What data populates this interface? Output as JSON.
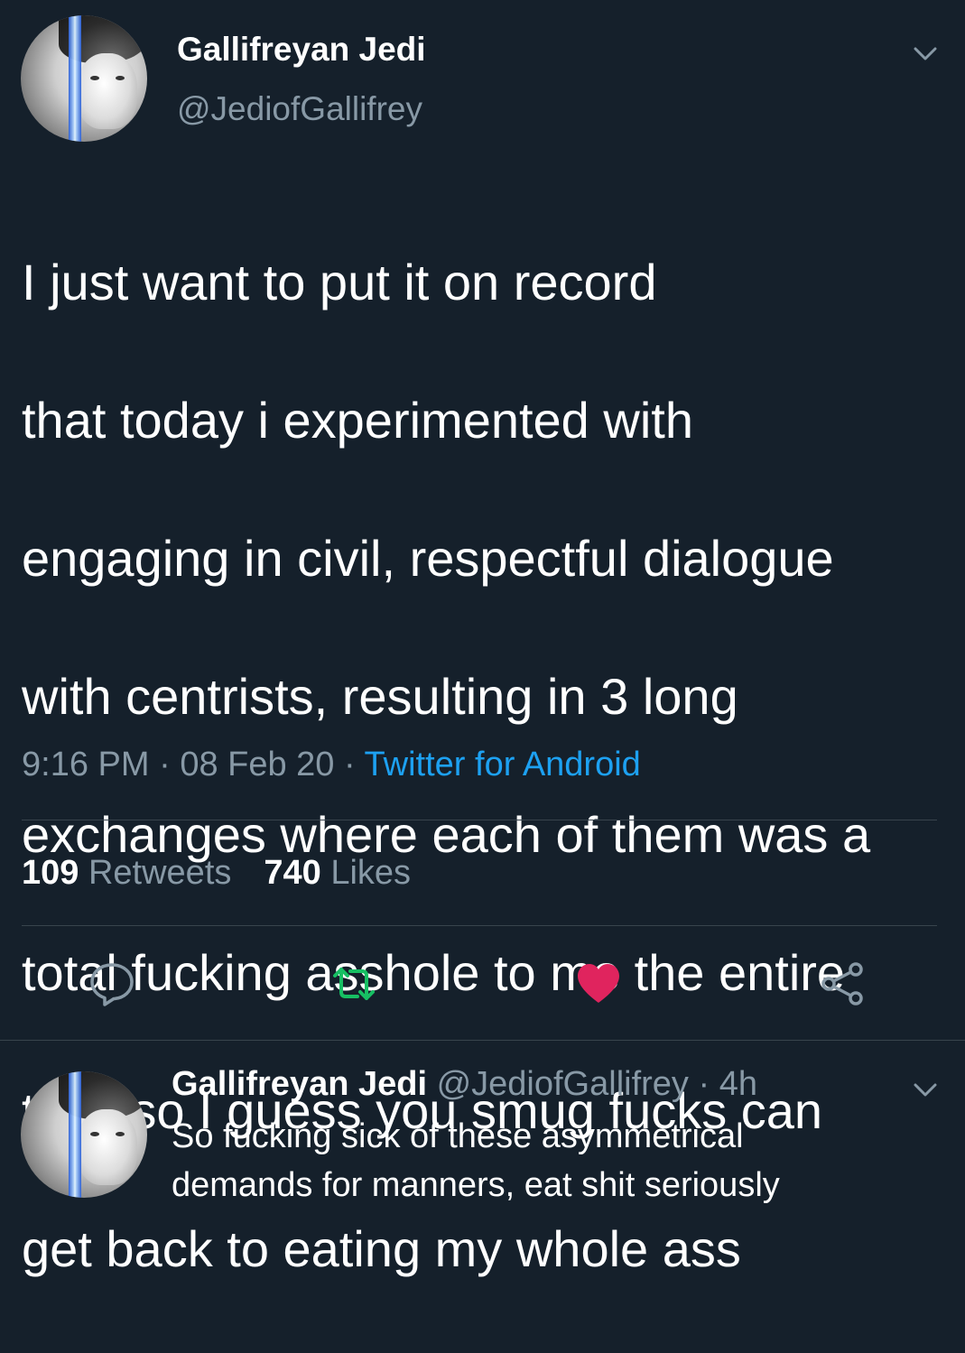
{
  "tweet": {
    "author_name": "Gallifreyan Jedi",
    "author_handle": "@JediofGallifrey",
    "text_lines": [
      "I just want to put it on record",
      "that today i experimented with",
      "engaging in civil, respectful dialogue",
      "with centrists, resulting in 3 long",
      "exchanges where each of them was a",
      "total fucking asshole to me the entire",
      "time so I guess you smug fucks can",
      "get back to eating my whole ass"
    ],
    "time": "9:16 PM",
    "separator": " · ",
    "date": "08 Feb 20",
    "source": "Twitter for Android",
    "retweets_count": "109",
    "retweets_label": "Retweets",
    "likes_count": "740",
    "likes_label": "Likes",
    "actions": [
      "reply-icon",
      "retweet-icon",
      "like-icon",
      "share-icon"
    ],
    "liked": true
  },
  "reply": {
    "author_name": "Gallifreyan Jedi",
    "author_handle": "@JediofGallifrey",
    "separator": " · ",
    "age": "4h",
    "text_lines": [
      "So fucking sick of these asymmetrical",
      "demands for manners, eat shit seriously"
    ]
  },
  "colors": {
    "background": "#15202b",
    "primary_text": "#ffffff",
    "secondary_text": "#8899a6",
    "link": "#1da1f2",
    "retweet_green": "#17bf63",
    "like_red": "#e0245e",
    "divider": "#38444d"
  }
}
